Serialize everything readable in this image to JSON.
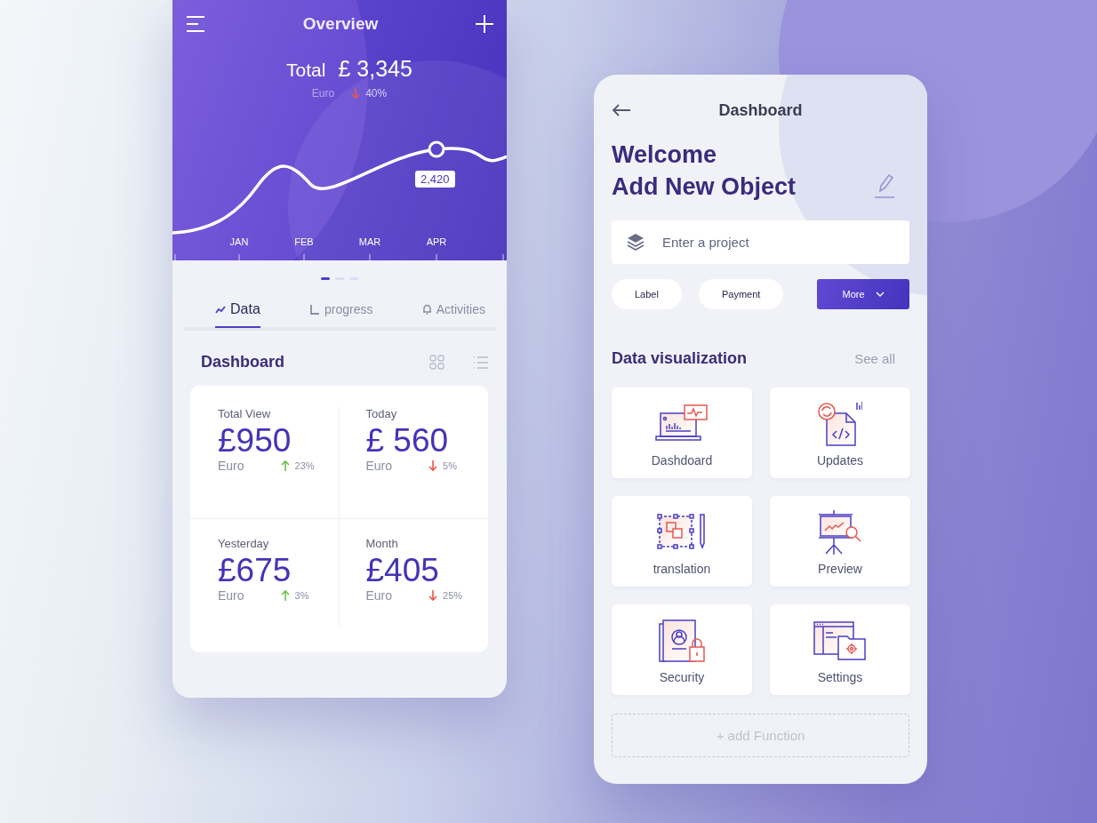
{
  "overview": {
    "title": "Overview",
    "total_label": "Total",
    "total_value": "£ 3,345",
    "currency": "Euro",
    "rising": false,
    "change": "40%",
    "chart": {
      "point_label": "2,420",
      "months": [
        "JAN",
        "FEB",
        "MAR",
        "APR"
      ]
    },
    "pager": [
      {
        "selected": true
      },
      {
        "selected": false
      },
      {
        "selected": false
      }
    ],
    "tabs": [
      {
        "label": "Data",
        "selected": true
      },
      {
        "label": "progress",
        "selected": false
      },
      {
        "label": "Activities",
        "selected": false
      }
    ],
    "section_title": "Dashboard",
    "stats": [
      {
        "label": "Total View",
        "value": "£950",
        "currency": "Euro",
        "rising": true,
        "change": "23%"
      },
      {
        "label": "Today",
        "value": "£ 560",
        "currency": "Euro",
        "rising": false,
        "change": "5%"
      },
      {
        "label": "Yesterday",
        "value": "£675",
        "currency": "Euro",
        "rising": true,
        "change": "3%"
      },
      {
        "label": "Month",
        "value": "£405",
        "currency": "Euro",
        "rising": false,
        "change": "25%"
      }
    ]
  },
  "dashboard": {
    "title": "Dashboard",
    "heading": [
      "Welcome",
      "Add New Object"
    ],
    "search": {
      "placeholder": "Enter a project"
    },
    "chips": [
      {
        "label": "Label",
        "kind": "pill"
      },
      {
        "label": "Payment",
        "kind": "pill"
      },
      {
        "label": "More",
        "kind": "dropdown"
      }
    ],
    "section_title": "Data visualization",
    "see_all": "See all",
    "tiles": [
      {
        "label": "Dashdoard"
      },
      {
        "label": "Updates"
      },
      {
        "label": "translation"
      },
      {
        "label": "Preview"
      },
      {
        "label": "Security"
      },
      {
        "label": "Settings"
      }
    ],
    "add_function": "+ add Function"
  }
}
